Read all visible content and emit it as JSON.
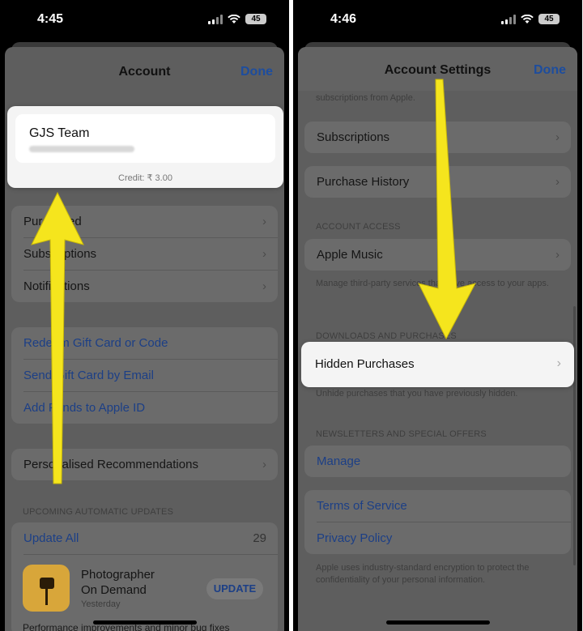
{
  "left": {
    "status": {
      "time": "4:45",
      "battery": "45"
    },
    "nav": {
      "title": "Account",
      "done": "Done"
    },
    "account": {
      "name": "GJS Team",
      "credit": "Credit: ₹ 3.00"
    },
    "group1": [
      "Purchased",
      "Subscriptions",
      "Notifications"
    ],
    "group2": [
      "Redeem Gift Card or Code",
      "Send Gift Card by Email",
      "Add Funds to Apple ID"
    ],
    "group3": [
      "Personalised Recommendations"
    ],
    "updates_header": "UPCOMING AUTOMATIC UPDATES",
    "update_all": "Update All",
    "update_count": "29",
    "app": {
      "name_line1": "Photographer",
      "name_line2": "On Demand",
      "date": "Yesterday",
      "button": "UPDATE"
    },
    "notes": "Performance improvements and minor bug fixes"
  },
  "right": {
    "status": {
      "time": "4:46",
      "battery": "45"
    },
    "nav": {
      "title": "Account Settings",
      "done": "Done"
    },
    "top_note": "subscriptions from Apple.",
    "group1": [
      "Subscriptions",
      "Purchase History"
    ],
    "access_header": "ACCOUNT ACCESS",
    "apple_music": "Apple Music",
    "access_note": "Manage third-party services that have access to your apps.",
    "downloads_header": "DOWNLOADS AND PURCHASES",
    "hidden_purchases": "Hidden Purchases",
    "hidden_note": "Unhide purchases that you have previously hidden.",
    "news_header": "NEWSLETTERS AND SPECIAL OFFERS",
    "manage": "Manage",
    "terms": "Terms of Service",
    "privacy": "Privacy Policy",
    "privacy_note": "Apple uses industry-standard encryption to protect the confidentiality of your personal information."
  },
  "colors": {
    "arrow": "#f5e51d",
    "link": "#1c3f86",
    "dim_sheet": "#5e5e5e"
  },
  "icons": [
    "chevron-right-icon",
    "signal-icon",
    "wifi-icon",
    "battery-icon",
    "arrow-up-icon",
    "arrow-down-icon",
    "app-icon"
  ]
}
